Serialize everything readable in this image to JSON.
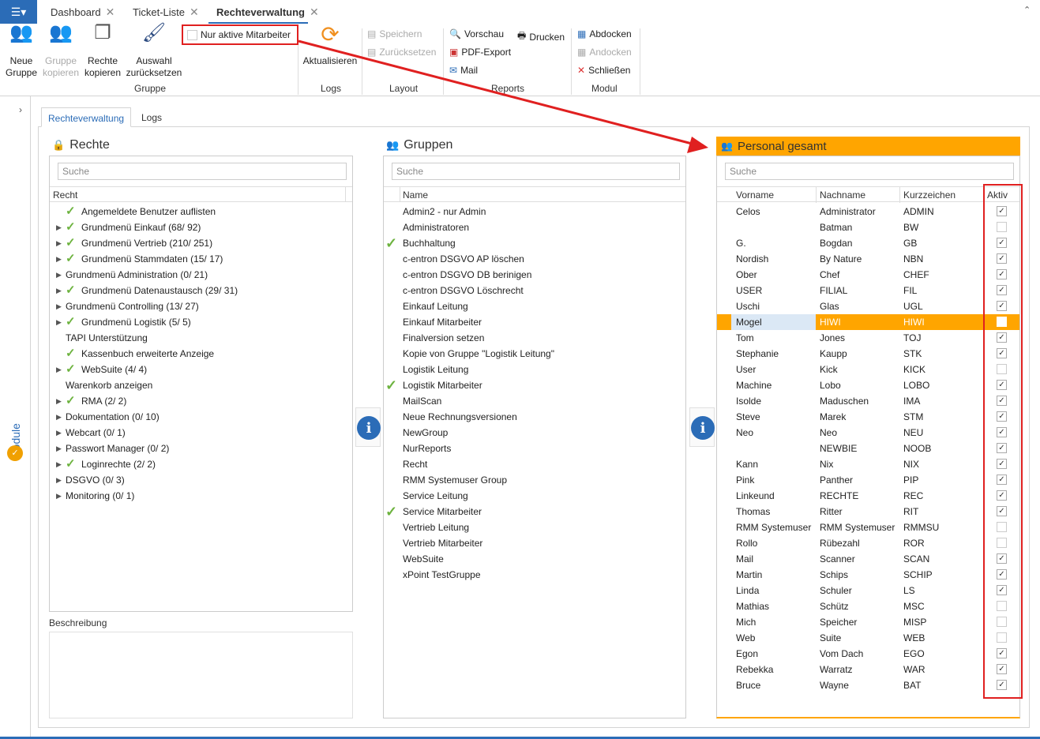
{
  "tabs": [
    {
      "label": "Dashboard"
    },
    {
      "label": "Ticket-Liste"
    },
    {
      "label": "Rechteverwaltung"
    }
  ],
  "ribbon": {
    "neue_gruppe": "Neue Gruppe",
    "gruppe_kopieren": "Gruppe kopieren",
    "rechte_kopieren": "Rechte kopieren",
    "auswahl_zuruecksetzen": "Auswahl zurücksetzen",
    "group_gruppe": "Gruppe",
    "nur_aktive": "Nur aktive Mitarbeiter",
    "aktualisieren": "Aktualisieren",
    "group_logs": "Logs",
    "speichern": "Speichern",
    "zuruecksetzen": "Zurücksetzen",
    "group_layout": "Layout",
    "vorschau": "Vorschau",
    "drucken": "Drucken",
    "pdf_export": "PDF-Export",
    "mail": "Mail",
    "group_reports": "Reports",
    "abdocken": "Abdocken",
    "andocken": "Andocken",
    "schliessen": "Schließen",
    "group_modul": "Modul"
  },
  "sidebar": {
    "module_label": "Module"
  },
  "subtabs": [
    {
      "label": "Rechteverwaltung"
    },
    {
      "label": "Logs"
    }
  ],
  "rechte": {
    "title": "Rechte",
    "search_placeholder": "Suche",
    "column": "Recht",
    "items": [
      {
        "label": "Angemeldete Benutzer auflisten",
        "expand": false,
        "check": true
      },
      {
        "label": "Grundmenü Einkauf (68/ 92)",
        "expand": true,
        "check": true
      },
      {
        "label": "Grundmenü Vertrieb (210/ 251)",
        "expand": true,
        "check": true
      },
      {
        "label": "Grundmenü Stammdaten (15/ 17)",
        "expand": true,
        "check": true
      },
      {
        "label": "Grundmenü Administration (0/ 21)",
        "expand": true,
        "check": false
      },
      {
        "label": "Grundmenü Datenaustausch (29/ 31)",
        "expand": true,
        "check": true
      },
      {
        "label": "Grundmenü Controlling (13/ 27)",
        "expand": true,
        "check": false
      },
      {
        "label": "Grundmenü Logistik (5/ 5)",
        "expand": true,
        "check": true
      },
      {
        "label": "TAPI Unterstützung",
        "expand": false,
        "check": false
      },
      {
        "label": "Kassenbuch erweiterte Anzeige",
        "expand": false,
        "check": true
      },
      {
        "label": "WebSuite (4/ 4)",
        "expand": true,
        "check": true
      },
      {
        "label": "Warenkorb anzeigen",
        "expand": false,
        "check": false
      },
      {
        "label": "RMA (2/ 2)",
        "expand": true,
        "check": true
      },
      {
        "label": "Dokumentation (0/ 10)",
        "expand": true,
        "check": false
      },
      {
        "label": "Webcart (0/ 1)",
        "expand": true,
        "check": false
      },
      {
        "label": "Passwort Manager (0/ 2)",
        "expand": true,
        "check": false
      },
      {
        "label": "Loginrechte (2/ 2)",
        "expand": true,
        "check": true
      },
      {
        "label": "DSGVO (0/ 3)",
        "expand": true,
        "check": false
      },
      {
        "label": "Monitoring (0/ 1)",
        "expand": true,
        "check": false
      }
    ],
    "beschreibung": "Beschreibung"
  },
  "gruppen": {
    "title": "Gruppen",
    "search_placeholder": "Suche",
    "column": "Name",
    "items": [
      {
        "label": "Admin2 - nur Admin",
        "check": false
      },
      {
        "label": "Administratoren",
        "check": false
      },
      {
        "label": "Buchhaltung",
        "check": true
      },
      {
        "label": "c-entron DSGVO AP löschen",
        "check": false
      },
      {
        "label": "c-entron DSGVO DB berinigen",
        "check": false
      },
      {
        "label": "c-entron DSGVO Löschrecht",
        "check": false
      },
      {
        "label": "Einkauf Leitung",
        "check": false
      },
      {
        "label": "Einkauf Mitarbeiter",
        "check": false
      },
      {
        "label": "Finalversion setzen",
        "check": false
      },
      {
        "label": "Kopie von Gruppe \"Logistik Leitung\"",
        "check": false
      },
      {
        "label": "Logistik Leitung",
        "check": false
      },
      {
        "label": "Logistik Mitarbeiter",
        "check": true
      },
      {
        "label": "MailScan",
        "check": false
      },
      {
        "label": "Neue Rechnungsversionen",
        "check": false
      },
      {
        "label": "NewGroup",
        "check": false
      },
      {
        "label": "NurReports",
        "check": false
      },
      {
        "label": "Recht",
        "check": false
      },
      {
        "label": "RMM Systemuser Group",
        "check": false
      },
      {
        "label": "Service Leitung",
        "check": false
      },
      {
        "label": "Service Mitarbeiter",
        "check": true
      },
      {
        "label": "Vertrieb Leitung",
        "check": false
      },
      {
        "label": "Vertrieb Mitarbeiter",
        "check": false
      },
      {
        "label": "WebSuite",
        "check": false
      },
      {
        "label": "xPoint TestGruppe",
        "check": false
      }
    ]
  },
  "personal": {
    "title": "Personal gesamt",
    "search_placeholder": "Suche",
    "columns": {
      "vorname": "Vorname",
      "nachname": "Nachname",
      "kurz": "Kurzzeichen",
      "aktiv": "Aktiv"
    },
    "rows": [
      {
        "vorname": "Celos",
        "nachname": "Administrator",
        "kurz": "ADMIN",
        "aktiv": true
      },
      {
        "vorname": "",
        "nachname": "Batman",
        "kurz": "BW",
        "aktiv": false
      },
      {
        "vorname": "G.",
        "nachname": "Bogdan",
        "kurz": "GB",
        "aktiv": true
      },
      {
        "vorname": "Nordish",
        "nachname": "By Nature",
        "kurz": "NBN",
        "aktiv": true
      },
      {
        "vorname": "Ober",
        "nachname": "Chef",
        "kurz": "CHEF",
        "aktiv": true
      },
      {
        "vorname": "USER",
        "nachname": "FILIAL",
        "kurz": "FIL",
        "aktiv": true
      },
      {
        "vorname": "Uschi",
        "nachname": "Glas",
        "kurz": "UGL",
        "aktiv": true
      },
      {
        "vorname": "Mogel",
        "nachname": "HIWI",
        "kurz": "HIWI",
        "aktiv": false,
        "selected": true
      },
      {
        "vorname": "Tom",
        "nachname": "Jones",
        "kurz": "TOJ",
        "aktiv": true
      },
      {
        "vorname": "Stephanie",
        "nachname": "Kaupp",
        "kurz": "STK",
        "aktiv": true
      },
      {
        "vorname": "User",
        "nachname": "Kick",
        "kurz": "KICK",
        "aktiv": false
      },
      {
        "vorname": "Machine",
        "nachname": "Lobo",
        "kurz": "LOBO",
        "aktiv": true
      },
      {
        "vorname": "Isolde",
        "nachname": "Maduschen",
        "kurz": "IMA",
        "aktiv": true
      },
      {
        "vorname": "Steve",
        "nachname": "Marek",
        "kurz": "STM",
        "aktiv": true
      },
      {
        "vorname": "Neo",
        "nachname": "Neo",
        "kurz": "NEU",
        "aktiv": true
      },
      {
        "vorname": "",
        "nachname": "NEWBIE",
        "kurz": "NOOB",
        "aktiv": true
      },
      {
        "vorname": "Kann",
        "nachname": "Nix",
        "kurz": "NIX",
        "aktiv": true
      },
      {
        "vorname": "Pink",
        "nachname": "Panther",
        "kurz": "PIP",
        "aktiv": true
      },
      {
        "vorname": "Linkeund",
        "nachname": "RECHTE",
        "kurz": "REC",
        "aktiv": true
      },
      {
        "vorname": "Thomas",
        "nachname": "Ritter",
        "kurz": "RIT",
        "aktiv": true
      },
      {
        "vorname": "RMM Systemuser",
        "nachname": "RMM Systemuser",
        "kurz": "RMMSU",
        "aktiv": false
      },
      {
        "vorname": "Rollo",
        "nachname": "Rübezahl",
        "kurz": "ROR",
        "aktiv": false
      },
      {
        "vorname": "Mail",
        "nachname": "Scanner",
        "kurz": "SCAN",
        "aktiv": true
      },
      {
        "vorname": "Martin",
        "nachname": "Schips",
        "kurz": "SCHIP",
        "aktiv": true
      },
      {
        "vorname": "Linda",
        "nachname": "Schuler",
        "kurz": "LS",
        "aktiv": true
      },
      {
        "vorname": "Mathias",
        "nachname": "Schütz",
        "kurz": "MSC",
        "aktiv": false
      },
      {
        "vorname": "Mich",
        "nachname": "Speicher",
        "kurz": "MISP",
        "aktiv": false
      },
      {
        "vorname": "Web",
        "nachname": "Suite",
        "kurz": "WEB",
        "aktiv": false
      },
      {
        "vorname": "Egon",
        "nachname": "Vom Dach",
        "kurz": "EGO",
        "aktiv": true
      },
      {
        "vorname": "Rebekka",
        "nachname": "Warratz",
        "kurz": "WAR",
        "aktiv": true
      },
      {
        "vorname": "Bruce",
        "nachname": "Wayne",
        "kurz": "BAT",
        "aktiv": true
      }
    ]
  },
  "colors": {
    "accent": "#2b6cb7",
    "highlight": "#ffa500",
    "annotation": "#e02020",
    "check": "#6db33f"
  }
}
